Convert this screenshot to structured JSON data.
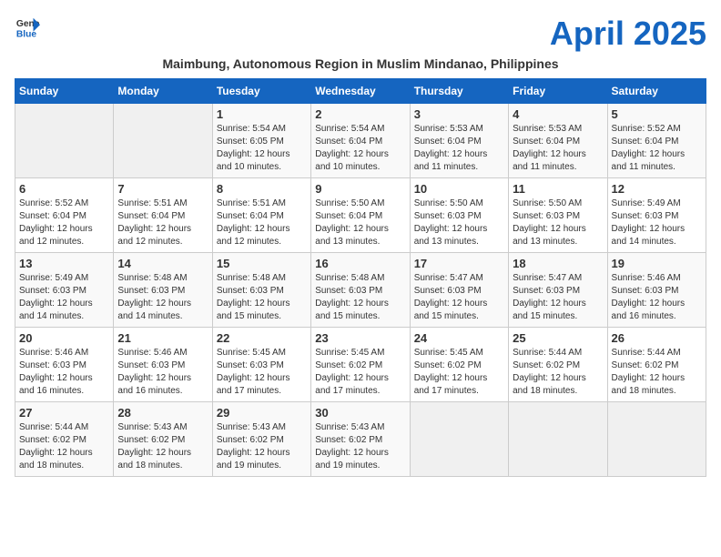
{
  "logo": {
    "line1": "General",
    "line2": "Blue"
  },
  "title": "April 2025",
  "location": "Maimbung, Autonomous Region in Muslim Mindanao, Philippines",
  "days_of_week": [
    "Sunday",
    "Monday",
    "Tuesday",
    "Wednesday",
    "Thursday",
    "Friday",
    "Saturday"
  ],
  "weeks": [
    [
      {
        "day": "",
        "info": ""
      },
      {
        "day": "",
        "info": ""
      },
      {
        "day": "1",
        "info": "Sunrise: 5:54 AM\nSunset: 6:05 PM\nDaylight: 12 hours\nand 10 minutes."
      },
      {
        "day": "2",
        "info": "Sunrise: 5:54 AM\nSunset: 6:04 PM\nDaylight: 12 hours\nand 10 minutes."
      },
      {
        "day": "3",
        "info": "Sunrise: 5:53 AM\nSunset: 6:04 PM\nDaylight: 12 hours\nand 11 minutes."
      },
      {
        "day": "4",
        "info": "Sunrise: 5:53 AM\nSunset: 6:04 PM\nDaylight: 12 hours\nand 11 minutes."
      },
      {
        "day": "5",
        "info": "Sunrise: 5:52 AM\nSunset: 6:04 PM\nDaylight: 12 hours\nand 11 minutes."
      }
    ],
    [
      {
        "day": "6",
        "info": "Sunrise: 5:52 AM\nSunset: 6:04 PM\nDaylight: 12 hours\nand 12 minutes."
      },
      {
        "day": "7",
        "info": "Sunrise: 5:51 AM\nSunset: 6:04 PM\nDaylight: 12 hours\nand 12 minutes."
      },
      {
        "day": "8",
        "info": "Sunrise: 5:51 AM\nSunset: 6:04 PM\nDaylight: 12 hours\nand 12 minutes."
      },
      {
        "day": "9",
        "info": "Sunrise: 5:50 AM\nSunset: 6:04 PM\nDaylight: 12 hours\nand 13 minutes."
      },
      {
        "day": "10",
        "info": "Sunrise: 5:50 AM\nSunset: 6:03 PM\nDaylight: 12 hours\nand 13 minutes."
      },
      {
        "day": "11",
        "info": "Sunrise: 5:50 AM\nSunset: 6:03 PM\nDaylight: 12 hours\nand 13 minutes."
      },
      {
        "day": "12",
        "info": "Sunrise: 5:49 AM\nSunset: 6:03 PM\nDaylight: 12 hours\nand 14 minutes."
      }
    ],
    [
      {
        "day": "13",
        "info": "Sunrise: 5:49 AM\nSunset: 6:03 PM\nDaylight: 12 hours\nand 14 minutes."
      },
      {
        "day": "14",
        "info": "Sunrise: 5:48 AM\nSunset: 6:03 PM\nDaylight: 12 hours\nand 14 minutes."
      },
      {
        "day": "15",
        "info": "Sunrise: 5:48 AM\nSunset: 6:03 PM\nDaylight: 12 hours\nand 15 minutes."
      },
      {
        "day": "16",
        "info": "Sunrise: 5:48 AM\nSunset: 6:03 PM\nDaylight: 12 hours\nand 15 minutes."
      },
      {
        "day": "17",
        "info": "Sunrise: 5:47 AM\nSunset: 6:03 PM\nDaylight: 12 hours\nand 15 minutes."
      },
      {
        "day": "18",
        "info": "Sunrise: 5:47 AM\nSunset: 6:03 PM\nDaylight: 12 hours\nand 15 minutes."
      },
      {
        "day": "19",
        "info": "Sunrise: 5:46 AM\nSunset: 6:03 PM\nDaylight: 12 hours\nand 16 minutes."
      }
    ],
    [
      {
        "day": "20",
        "info": "Sunrise: 5:46 AM\nSunset: 6:03 PM\nDaylight: 12 hours\nand 16 minutes."
      },
      {
        "day": "21",
        "info": "Sunrise: 5:46 AM\nSunset: 6:03 PM\nDaylight: 12 hours\nand 16 minutes."
      },
      {
        "day": "22",
        "info": "Sunrise: 5:45 AM\nSunset: 6:03 PM\nDaylight: 12 hours\nand 17 minutes."
      },
      {
        "day": "23",
        "info": "Sunrise: 5:45 AM\nSunset: 6:02 PM\nDaylight: 12 hours\nand 17 minutes."
      },
      {
        "day": "24",
        "info": "Sunrise: 5:45 AM\nSunset: 6:02 PM\nDaylight: 12 hours\nand 17 minutes."
      },
      {
        "day": "25",
        "info": "Sunrise: 5:44 AM\nSunset: 6:02 PM\nDaylight: 12 hours\nand 18 minutes."
      },
      {
        "day": "26",
        "info": "Sunrise: 5:44 AM\nSunset: 6:02 PM\nDaylight: 12 hours\nand 18 minutes."
      }
    ],
    [
      {
        "day": "27",
        "info": "Sunrise: 5:44 AM\nSunset: 6:02 PM\nDaylight: 12 hours\nand 18 minutes."
      },
      {
        "day": "28",
        "info": "Sunrise: 5:43 AM\nSunset: 6:02 PM\nDaylight: 12 hours\nand 18 minutes."
      },
      {
        "day": "29",
        "info": "Sunrise: 5:43 AM\nSunset: 6:02 PM\nDaylight: 12 hours\nand 19 minutes."
      },
      {
        "day": "30",
        "info": "Sunrise: 5:43 AM\nSunset: 6:02 PM\nDaylight: 12 hours\nand 19 minutes."
      },
      {
        "day": "",
        "info": ""
      },
      {
        "day": "",
        "info": ""
      },
      {
        "day": "",
        "info": ""
      }
    ]
  ]
}
